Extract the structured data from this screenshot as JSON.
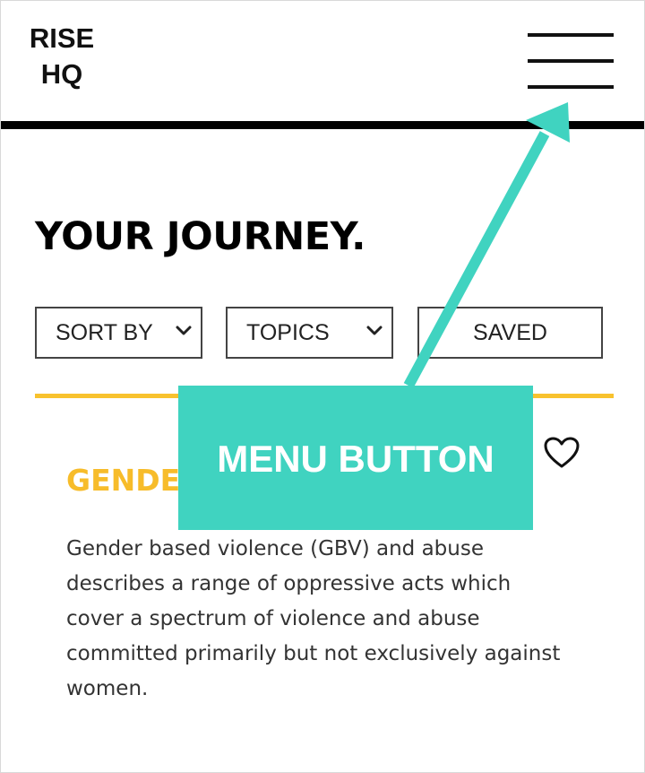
{
  "header": {
    "logo_line1": "RISE",
    "logo_line2": "HQ",
    "menu_icon": "hamburger-menu-icon"
  },
  "page": {
    "title": "YOUR JOURNEY."
  },
  "filters": {
    "sort_label": "SORT BY",
    "topics_label": "TOPICS",
    "saved_label": "SAVED"
  },
  "card": {
    "title": "GENDE",
    "description": "Gender based violence (GBV) and abuse describes a range of oppressive acts which cover a spectrum of violence and abuse committed primarily but not exclusively against women.",
    "favorite_icon": "heart-outline-icon"
  },
  "annotation": {
    "label": "MENU BUTTON"
  },
  "colors": {
    "accent_yellow": "#f7bc2a",
    "callout_teal": "#40d3c0",
    "text_dark": "#333333"
  }
}
